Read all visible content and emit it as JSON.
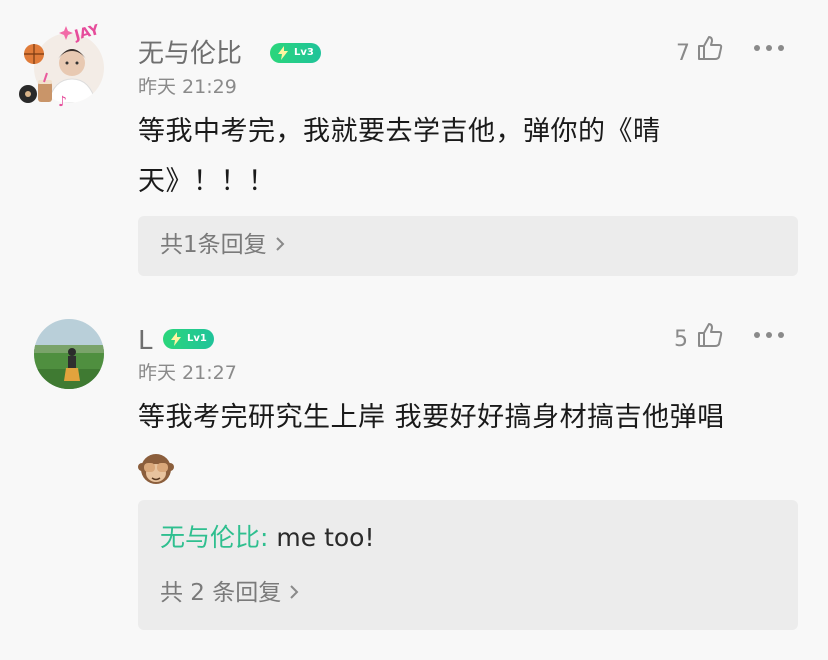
{
  "comments": [
    {
      "username": "无与伦比",
      "level": "Lv3",
      "timestamp": "昨天 21:29",
      "likes": "7",
      "text": "等我中考完，我就要去学吉他，弹你的《晴天》！！！",
      "replies_summary": "共1条回复"
    },
    {
      "username": "L",
      "level": "Lv1",
      "timestamp": "昨天 21:27",
      "likes": "5",
      "text": "等我考完研究生上岸 我要好好搞身材搞吉他弹唱",
      "emoji": "see-no-evil-monkey",
      "reply_preview": {
        "author": "无与伦比:",
        "content": " me too!"
      },
      "replies_summary": "共 2 条回复"
    }
  ],
  "colors": {
    "background": "#f8f8f8",
    "reply_box": "#ececec",
    "level_badge": "#24cf86",
    "reply_author": "#2fbf8f",
    "body_text": "#1a1a1a",
    "meta_text": "#8a8a8a"
  }
}
